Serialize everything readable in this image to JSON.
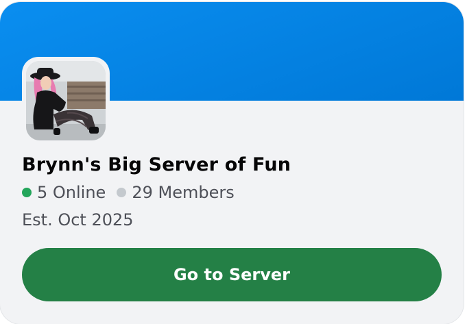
{
  "server": {
    "name": "Brynn's Big Server of Fun",
    "online_text": "5 Online",
    "members_text": "29 Members",
    "established": "Est. Oct 2025",
    "button_label": "Go to Server"
  },
  "colors": {
    "banner": "#0a8ef0",
    "online_dot": "#23a55a",
    "members_dot": "#c4c9ce",
    "button": "#248046"
  }
}
